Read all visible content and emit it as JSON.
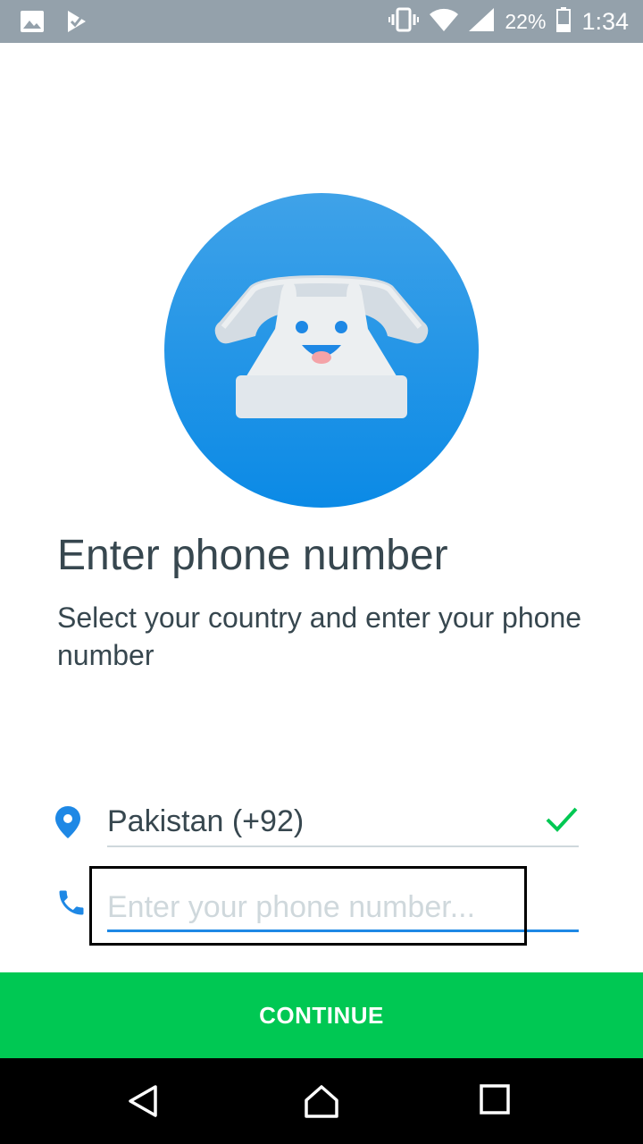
{
  "status_bar": {
    "battery": "22%",
    "time": "1:34",
    "icons": [
      "image-icon",
      "notification-check-icon",
      "vibrate-icon",
      "wifi-icon",
      "cell-signal-icon",
      "battery-icon"
    ]
  },
  "header": {
    "title": "Enter phone number",
    "subtitle": "Select your country and enter your phone number"
  },
  "form": {
    "country_value": "Pakistan (+92)",
    "phone_value": "",
    "phone_placeholder": "Enter your phone number..."
  },
  "actions": {
    "continue_label": "CONTINUE"
  },
  "nav": {
    "buttons": [
      "back",
      "home",
      "recents"
    ]
  },
  "colors": {
    "accent_blue": "#1e88e5",
    "success_green": "#00c853",
    "text_dark": "#37474f",
    "status_bar": "#94a1ab"
  }
}
